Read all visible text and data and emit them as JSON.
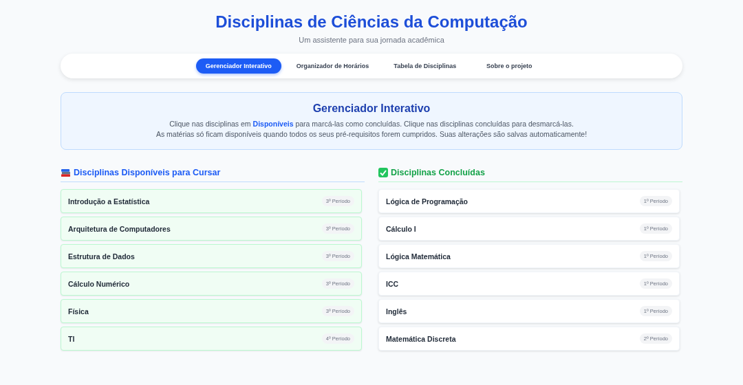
{
  "header": {
    "title": "Disciplinas de Ciências da Computação",
    "subtitle": "Um assistente para sua jornada acadêmica"
  },
  "tabs": [
    {
      "label": "Gerenciador Interativo",
      "selected": true
    },
    {
      "label": "Organizador de Horários",
      "selected": false
    },
    {
      "label": "Tabela de Disciplinas",
      "selected": false
    },
    {
      "label": "Sobre o projeto",
      "selected": false
    }
  ],
  "intro": {
    "title": "Gerenciador Interativo",
    "paragraphs": [
      "Clique nas disciplinas em **Disponíveis** para marcá-las como concluídas. Clique nas disciplinas concluídas para desmarcá-las.",
      "As matérias só ficam disponíveis quando todos os seus pré-requisitos forem cumpridos. Suas alterações são salvas automaticamente!"
    ]
  },
  "sections": [
    {
      "kind": "available",
      "title": "Disciplinas Disponíveis para Cursar",
      "courses": [
        {
          "name": "Introdução a Estatística",
          "period": "3º Período"
        },
        {
          "name": "Arquitetura de Computadores",
          "period": "3º Período"
        },
        {
          "name": "Estrutura de Dados",
          "period": "3º Período"
        },
        {
          "name": "Cálculo Numérico",
          "period": "3º Período"
        },
        {
          "name": "Física",
          "period": "3º Período"
        },
        {
          "name": "TI",
          "period": "4º Período"
        }
      ]
    },
    {
      "kind": "completed",
      "title": "Disciplinas Concluídas",
      "courses": [
        {
          "name": "Lógica de Programação",
          "period": "1º Período"
        },
        {
          "name": "Cálculo I",
          "period": "1º Período"
        },
        {
          "name": "Lógica Matemática",
          "period": "1º Período"
        },
        {
          "name": "ICC",
          "period": "1º Período"
        },
        {
          "name": "Inglês",
          "period": "1º Período"
        },
        {
          "name": "Matemática Discreta",
          "period": "2º Período"
        }
      ]
    }
  ]
}
